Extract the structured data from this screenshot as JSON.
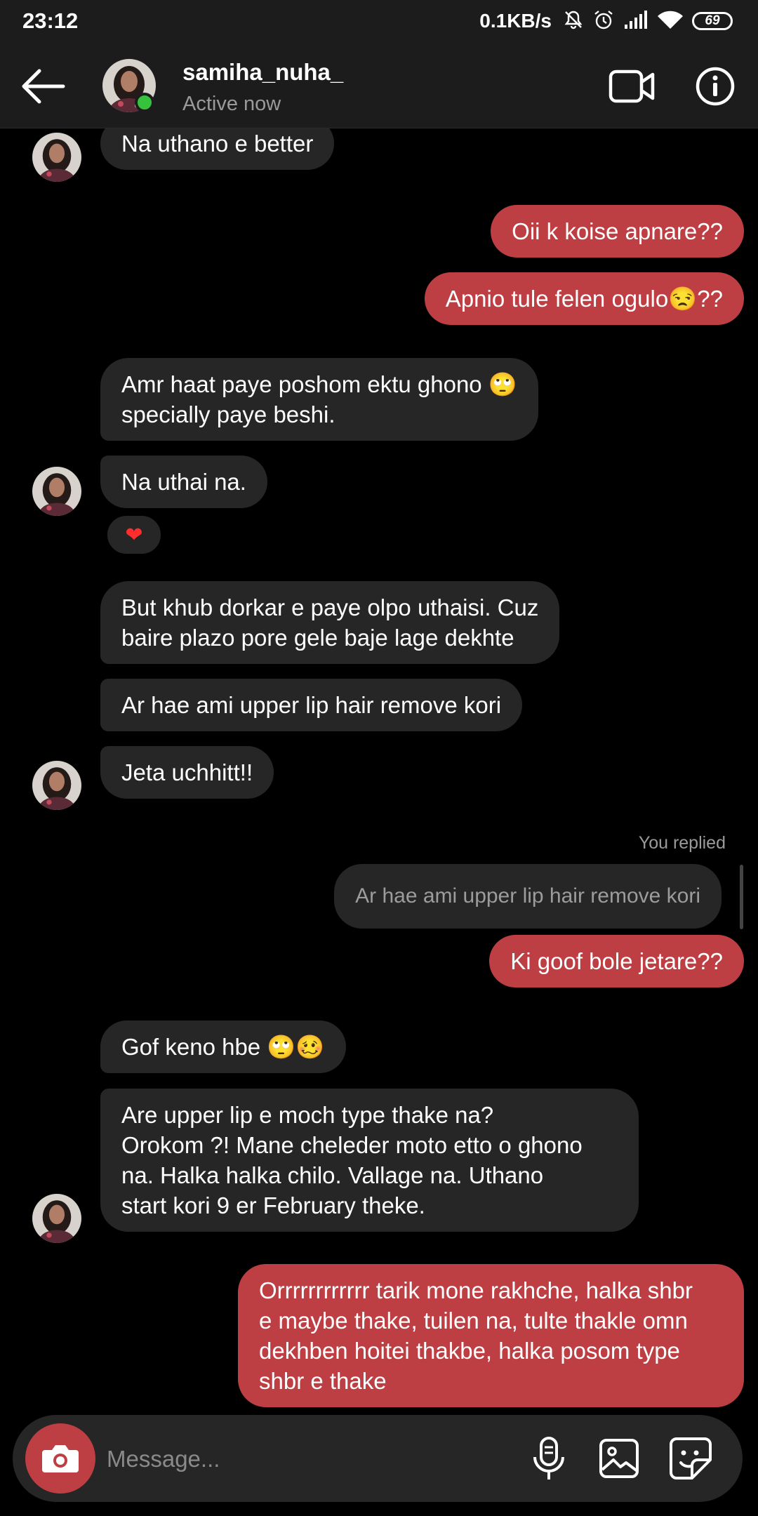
{
  "status_bar": {
    "time": "23:12",
    "net_speed": "0.1KB/s",
    "battery": "69",
    "icons": [
      "mute-bell-icon",
      "alarm-icon",
      "signal-icon",
      "wifi-icon",
      "battery-icon"
    ]
  },
  "header": {
    "contact_name": "samiha_nuha_",
    "status": "Active now",
    "icons": [
      "back-arrow-icon",
      "video-call-icon",
      "info-icon"
    ]
  },
  "messages": [
    {
      "from": "them",
      "text": "Na uthano e better"
    },
    {
      "from": "me",
      "text": "Oii k koise apnare??"
    },
    {
      "from": "me",
      "text": "Apnio tule felen ogulo😒??"
    },
    {
      "from": "them",
      "text": "Amr haat paye poshom ektu ghono 🙄\nspecially paye beshi."
    },
    {
      "from": "them",
      "text": "Na uthai na.",
      "reaction": "❤"
    },
    {
      "from": "them",
      "text": "But khub dorkar e paye olpo uthaisi. Cuz\nbaire plazo pore gele baje lage dekhte"
    },
    {
      "from": "them",
      "text": "Ar hae ami upper lip hair remove kori"
    },
    {
      "from": "them",
      "text": "Jeta uchhitt!!"
    },
    {
      "from": "me",
      "reply_label": "You replied",
      "quoted": "Ar hae ami upper lip hair remove kori",
      "text": "Ki goof bole jetare??"
    },
    {
      "from": "them",
      "text": "Gof keno hbe 🙄🥴"
    },
    {
      "from": "them",
      "text": "Are upper lip e moch type thake na?\nOrokom ?! Mane cheleder moto etto o ghono\nna. Halka halka chilo. Vallage na. Uthano\nstart kori 9 er February theke."
    },
    {
      "from": "me",
      "text": "Orrrrrrrrrrrr tarik mone rakhche, halka shbr\ne maybe thake, tuilen na, tulte thakle omn\ndekhben hoitei thakbe, halka posom type\nshbr e thake"
    }
  ],
  "composer": {
    "placeholder": "Message...",
    "icons": [
      "camera-icon",
      "microphone-icon",
      "gallery-icon",
      "sticker-icon"
    ]
  },
  "colors": {
    "background": "#000000",
    "incoming_bubble": "#262626",
    "outgoing_bubble": "#be3f43",
    "online": "#36c23c"
  }
}
